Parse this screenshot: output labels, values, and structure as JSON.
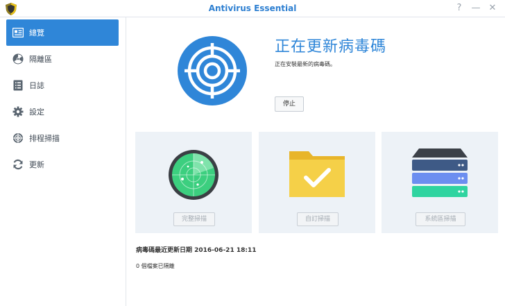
{
  "window": {
    "title": "Antivirus Essential",
    "help_glyph": "?",
    "minimize_glyph": "—",
    "close_glyph": "✕"
  },
  "sidebar": {
    "items": [
      {
        "label": "總覽",
        "icon": "overview-icon",
        "active": true
      },
      {
        "label": "隔離區",
        "icon": "radiation-icon",
        "active": false
      },
      {
        "label": "日誌",
        "icon": "log-icon",
        "active": false
      },
      {
        "label": "設定",
        "icon": "gear-icon",
        "active": false
      },
      {
        "label": "排程掃描",
        "icon": "target-icon",
        "active": false
      },
      {
        "label": "更新",
        "icon": "refresh-icon",
        "active": false
      }
    ]
  },
  "status": {
    "title": "正在更新病毒碼",
    "description": "正在安裝最新的病毒碼。",
    "stop_label": "停止"
  },
  "scan_cards": [
    {
      "label": "完整掃描",
      "icon": "radar-icon"
    },
    {
      "label": "自訂掃描",
      "icon": "folder-check-icon"
    },
    {
      "label": "系統區掃描",
      "icon": "server-stack-icon"
    }
  ],
  "footer": {
    "last_update": "病毒碼最近更新日期 2016-06-21 18:11",
    "quarantine": "0 個檔案已隔離"
  },
  "colors": {
    "accent": "#2f86d8",
    "card_bg": "#edf2f7",
    "title_blue": "#2d7fd1"
  }
}
